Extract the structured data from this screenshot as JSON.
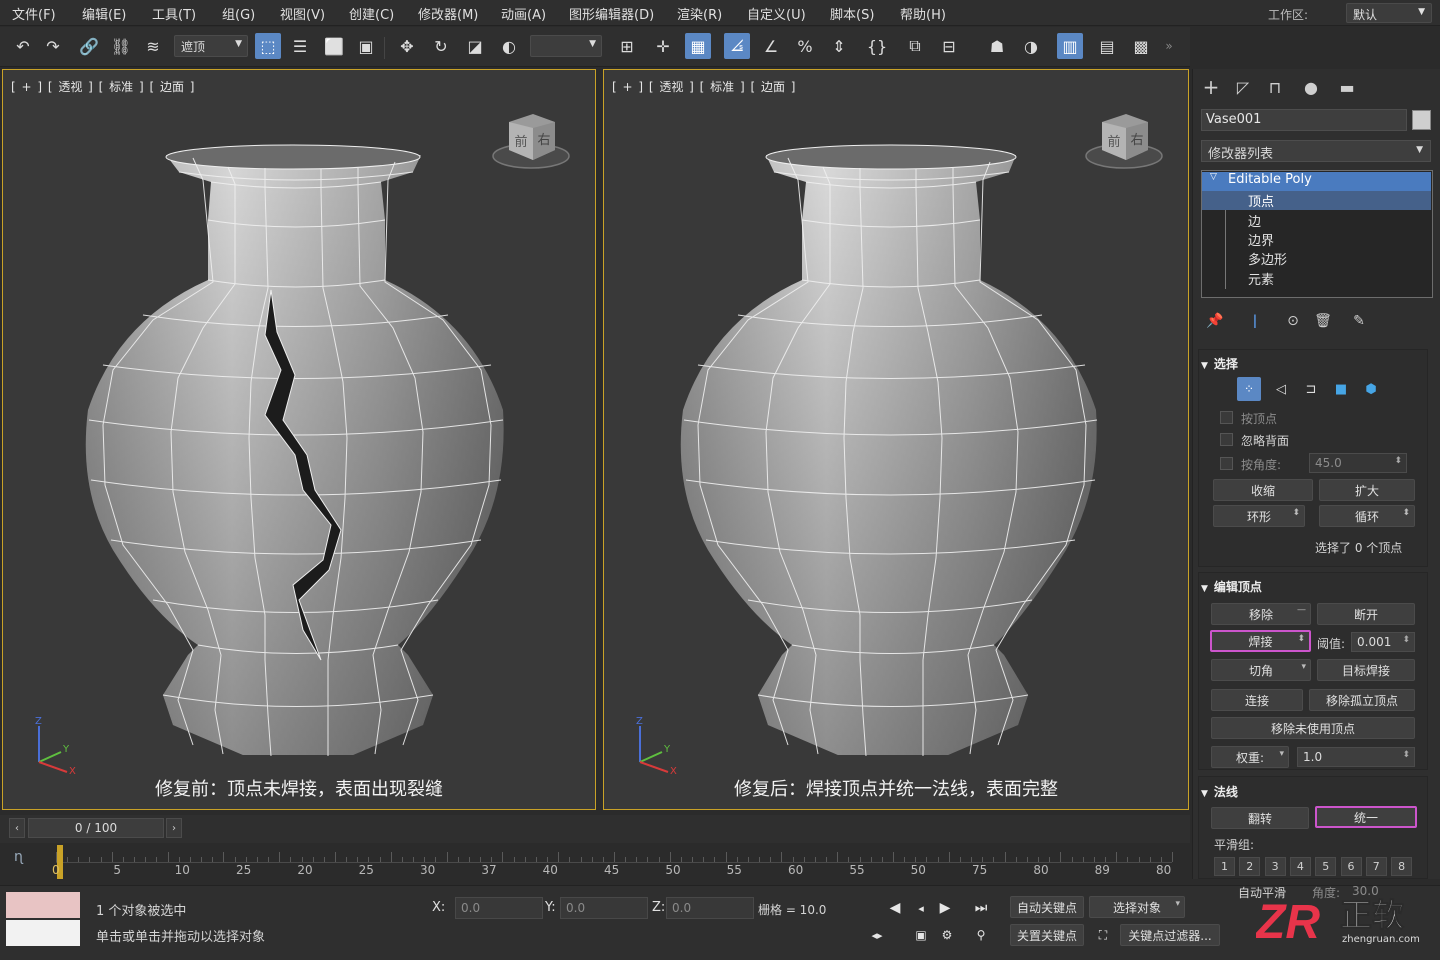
{
  "menu": [
    "文件(F)",
    "编辑(E)",
    "工具(T)",
    "组(G)",
    "视图(V)",
    "创建(C)",
    "修改器(M)",
    "动画(A)",
    "图形编辑器(D)",
    "渲染(R)",
    "自定义(U)",
    "脚本(S)",
    "帮助(H)"
  ],
  "workspace": {
    "label": "工作区:",
    "value": "默认"
  },
  "toolbar": {
    "filter": "遮顶"
  },
  "viewports": [
    {
      "label": "[ + ] [ 透视 ] [ 标准 ] [ 边面 ]",
      "caption": "修复前：顶点未焊接，表面出现裂缝",
      "cube_front": "前",
      "cube_right": "右"
    },
    {
      "label": "[ + ] [ 透视 ] [ 标准 ] [ 边面 ]",
      "caption": "修复后：焊接顶点并统一法线，表面完整",
      "cube_front": "前",
      "cube_right": "右"
    }
  ],
  "command_panel": {
    "object_name": "Vase001",
    "modifier_list": "修改器列表",
    "stack": {
      "base": "Editable Poly",
      "subs": [
        "顶点",
        "边",
        "边界",
        "多边形",
        "元素"
      ]
    },
    "selection": {
      "title": "选择",
      "by_vertex": "按顶点",
      "ignore_backface": "忽略背面",
      "by_angle": "按角度:",
      "angle_value": "45.0",
      "shrink": "收缩",
      "grow": "扩大",
      "ring": "环形",
      "loop": "循环",
      "status": "选择了 0 个顶点"
    },
    "edit_vertices": {
      "title": "编辑顶点",
      "remove": "移除",
      "break": "断开",
      "weld": "焊接",
      "threshold_label": "阈值:",
      "threshold_value": "0.001",
      "chamfer": "切角",
      "target_weld": "目标焊接",
      "connect": "连接",
      "remove_isolated": "移除孤立顶点",
      "remove_unused": "移除未使用顶点",
      "weight_label": "权重:",
      "weight_value": "1.0"
    },
    "normals": {
      "title": "法线",
      "flip": "翻转",
      "unify": "统一",
      "smoothing_groups": "平滑组:",
      "groups": [
        "1",
        "2",
        "3",
        "4",
        "5",
        "6",
        "7",
        "8"
      ],
      "auto_smooth": "自动平滑",
      "angle_label": "角度:",
      "angle_value": "30.0"
    }
  },
  "timeline": {
    "frame": "0 / 100",
    "ticks": [
      "0",
      "5",
      "10",
      "25",
      "20",
      "25",
      "30",
      "37",
      "40",
      "45",
      "50",
      "55",
      "60",
      "55",
      "50",
      "75",
      "80",
      "89",
      "80"
    ]
  },
  "status": {
    "selected": "1 个对象被选中",
    "hint": "单击或单击并拖动以选择对象",
    "x_label": "X:",
    "x": "0.0",
    "y_label": "Y:",
    "y": "0.0",
    "z_label": "Z:",
    "z": "0.0",
    "grid": "栅格 = 10.0",
    "auto_key": "自动关键点",
    "set_key": "关置关键点",
    "select_object": "选择对象",
    "key_filters": "关键点过滤器..."
  },
  "logo": {
    "mark": "ZR",
    "text": "正软",
    "url": "zhengruan.com"
  },
  "colors": {
    "accent": "#5b88c4",
    "highlight": "#cc55cc",
    "viewport_border": "#c9a227",
    "swatch_top": "#e8c4c4",
    "swatch_bottom": "#f2f2f2",
    "logo_red": "#e8344a"
  }
}
